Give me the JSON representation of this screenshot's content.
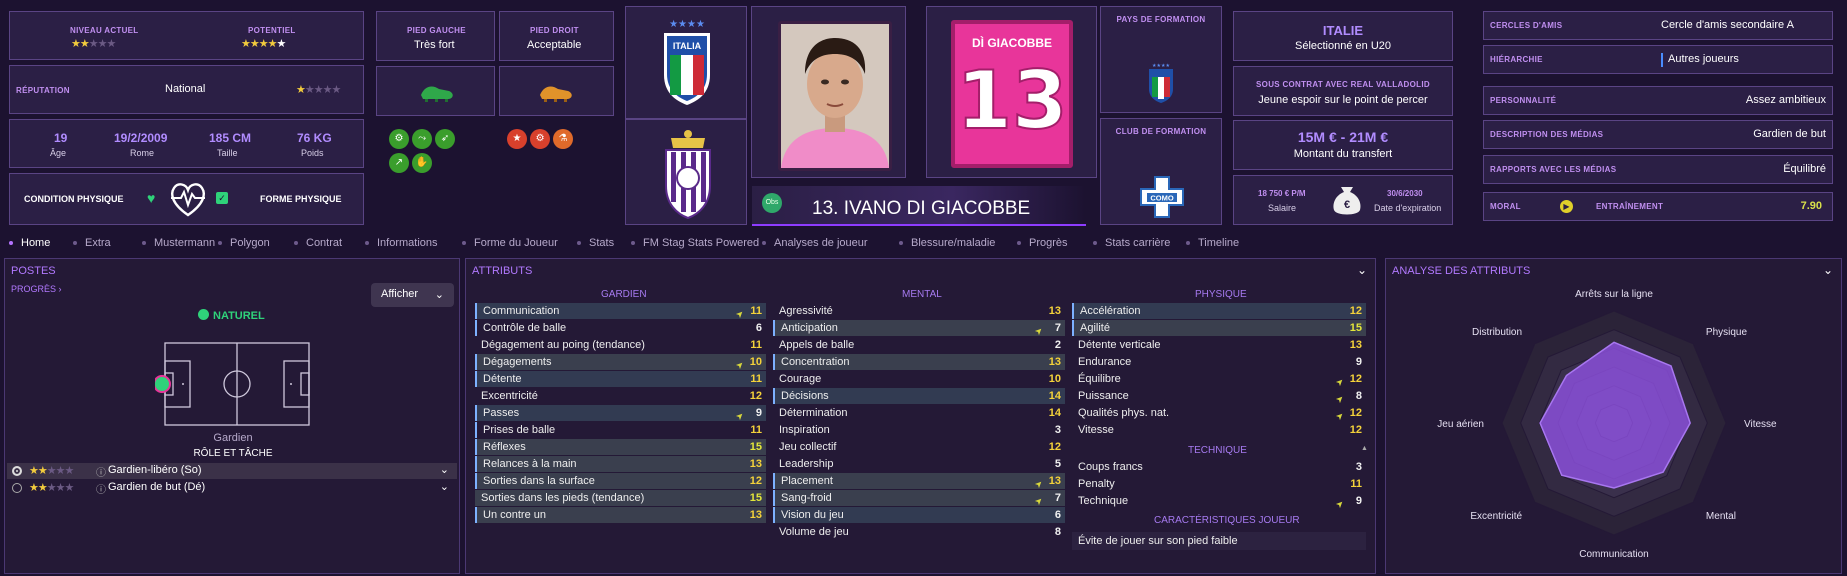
{
  "header": {
    "current_level_caption": "NIVEAU ACTUEL",
    "current_level_stars": 2,
    "potential_caption": "POTENTIEL",
    "potential_stars": 4.5,
    "reputation_caption": "RÉPUTATION",
    "reputation_value": "National",
    "reputation_stars": 1,
    "age_value": "19",
    "age_label": "Âge",
    "dob_value": "19/2/2009",
    "dob_label": "Rome",
    "height_value": "185 CM",
    "height_label": "Taille",
    "weight_value": "76 KG",
    "weight_label": "Poids",
    "condition_label": "CONDITION PHYSIQUE",
    "form_label": "FORME PHYSIQUE",
    "left_foot_caption": "PIED GAUCHE",
    "left_foot_value": "Très fort",
    "right_foot_caption": "PIED DROIT",
    "right_foot_value": "Acceptable",
    "shirt_name": "DÌ GIACOBBE",
    "shirt_number": "13",
    "player_name": "13. IVANO DI GIACOBBE",
    "obs_badge": "Obs",
    "training_country_caption": "PAYS DE FORMATION",
    "training_club_caption": "CLUB DE FORMATION",
    "italy_crest_text": "ITALIA",
    "como_crest_text": "COMO",
    "nation": "ITALIE",
    "nation_sub": "Sélectionné en U20",
    "contract_caption": "SOUS CONTRAT AVEC REAL VALLADOLID",
    "contract_value": "Jeune espoir sur le point de percer",
    "transfer_value": "15M € - 21M €",
    "transfer_label": "Montant du transfert",
    "wage_value": "18 750 € P/M",
    "wage_label": "Salaire",
    "expiry_value": "30/6/2030",
    "expiry_label": "Date d'expiration",
    "friends_caption": "CERCLES D'AMIS",
    "friends_value": "Cercle d'amis secondaire A",
    "hierarchy_caption": "HIÉRARCHIE",
    "hierarchy_value": "Autres joueurs",
    "personality_caption": "PERSONNALITÉ",
    "personality_value": "Assez ambitieux",
    "media_desc_caption": "DESCRIPTION DES MÉDIAS",
    "media_desc_value": "Gardien de but",
    "media_rel_caption": "RAPPORTS AVEC LES MÉDIAS",
    "media_rel_value": "Équilibré",
    "morale_caption": "MORAL",
    "training_caption": "ENTRAÎNEMENT",
    "training_value": "7.90"
  },
  "tabs": [
    "Home",
    "Extra",
    "Mustermann",
    "Polygon",
    "Contrat",
    "Informations",
    "Forme du Joueur",
    "Stats",
    "FM Stag Stats Powered",
    "Analyses de joueur",
    "Blessure/maladie",
    "Progrès",
    "Stats carrière",
    "Timeline"
  ],
  "positions": {
    "title": "POSTES",
    "progress_link": "PROGRÈS",
    "show_button": "Afficher",
    "natural": "NATUREL",
    "position_name": "Gardien",
    "role_caption": "RÔLE ET TÂCHE",
    "roles": [
      {
        "name": "Gardien-libéro (So)",
        "stars": 2
      },
      {
        "name": "Gardien de but (Dé)",
        "stars": 2
      }
    ]
  },
  "attributes": {
    "title": "ATTRIBUTS",
    "goalkeeper_title": "GARDIEN",
    "mental_title": "MENTAL",
    "physical_title": "PHYSIQUE",
    "technical_title": "TECHNIQUE",
    "traits_title": "CARACTÉRISTIQUES JOUEUR",
    "trait": "Évite de jouer sur son pied faible",
    "goalkeeper": [
      {
        "n": "Communication",
        "v": "11",
        "arr": true,
        "s": "b",
        "hl": true
      },
      {
        "n": "Contrôle de balle",
        "v": "6",
        "s": "n",
        "hl": true
      },
      {
        "n": "Dégagement au poing (tendance)",
        "v": "11",
        "s": "n"
      },
      {
        "n": "Dégagements",
        "v": "10",
        "arr": true,
        "s": "g",
        "hl": true
      },
      {
        "n": "Détente",
        "v": "11",
        "s": "b",
        "hl": true
      },
      {
        "n": "Excentricité",
        "v": "12",
        "s": "n"
      },
      {
        "n": "Passes",
        "v": "9",
        "arr": true,
        "s": "b",
        "hl": true
      },
      {
        "n": "Prises de balle",
        "v": "11",
        "s": "n",
        "hl": true
      },
      {
        "n": "Réflexes",
        "v": "15",
        "s": "g",
        "hl": true
      },
      {
        "n": "Relances à la main",
        "v": "13",
        "s": "g",
        "hl": true
      },
      {
        "n": "Sorties dans la surface",
        "v": "12",
        "s": "g",
        "hl": true
      },
      {
        "n": "Sorties dans les pieds (tendance)",
        "v": "15",
        "s": "g"
      },
      {
        "n": "Un contre un",
        "v": "13",
        "s": "g",
        "hl": true
      }
    ],
    "mental": [
      {
        "n": "Agressivité",
        "v": "13",
        "s": "n"
      },
      {
        "n": "Anticipation",
        "v": "7",
        "arr": true,
        "s": "g",
        "hl": true
      },
      {
        "n": "Appels de balle",
        "v": "2",
        "s": "n"
      },
      {
        "n": "Concentration",
        "v": "13",
        "s": "g",
        "hl": true
      },
      {
        "n": "Courage",
        "v": "10",
        "s": "n"
      },
      {
        "n": "Décisions",
        "v": "14",
        "s": "b",
        "hl": true
      },
      {
        "n": "Détermination",
        "v": "14",
        "s": "n"
      },
      {
        "n": "Inspiration",
        "v": "3",
        "s": "n"
      },
      {
        "n": "Jeu collectif",
        "v": "12",
        "s": "n"
      },
      {
        "n": "Leadership",
        "v": "5",
        "s": "n"
      },
      {
        "n": "Placement",
        "v": "13",
        "arr": true,
        "s": "g",
        "hl": true
      },
      {
        "n": "Sang-froid",
        "v": "7",
        "arr": true,
        "s": "g",
        "hl": true
      },
      {
        "n": "Vision du jeu",
        "v": "6",
        "s": "b",
        "hl": true
      },
      {
        "n": "Volume de jeu",
        "v": "8",
        "s": "n"
      }
    ],
    "physical": [
      {
        "n": "Accélération",
        "v": "12",
        "s": "b",
        "hl": true
      },
      {
        "n": "Agilité",
        "v": "15",
        "s": "g",
        "hl": true
      },
      {
        "n": "Détente verticale",
        "v": "13",
        "s": "n"
      },
      {
        "n": "Endurance",
        "v": "9",
        "s": "n"
      },
      {
        "n": "Équilibre",
        "v": "12",
        "arr": true,
        "s": "n"
      },
      {
        "n": "Puissance",
        "v": "8",
        "arr": true,
        "s": "n"
      },
      {
        "n": "Qualités phys. nat.",
        "v": "12",
        "arr": true,
        "s": "n"
      },
      {
        "n": "Vitesse",
        "v": "12",
        "s": "n"
      }
    ],
    "technical": [
      {
        "n": "Coups francs",
        "v": "3",
        "s": "n"
      },
      {
        "n": "Penalty",
        "v": "11",
        "s": "n"
      },
      {
        "n": "Technique",
        "v": "9",
        "arr": true,
        "s": "n"
      }
    ]
  },
  "analysis": {
    "title": "ANALYSE DES ATTRIBUTS",
    "axes": [
      "Arrêts sur la ligne",
      "Physique",
      "Vitesse",
      "Mental",
      "Communication",
      "Excentricité",
      "Jeu aérien",
      "Distribution"
    ],
    "values": [
      0.72,
      0.72,
      0.68,
      0.62,
      0.58,
      0.66,
      0.66,
      0.6
    ]
  },
  "colors": {
    "accent": "#b473ff",
    "bg": "#1c1230",
    "panel": "#2b1f45",
    "shirt": "#e8359a",
    "star": "#f2cb3d"
  }
}
